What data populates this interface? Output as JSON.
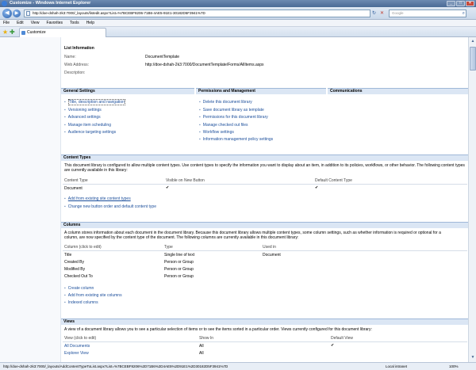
{
  "window": {
    "title": "Customize - Windows Internet Explorer",
    "controls": [
      "_",
      "□",
      "×"
    ]
  },
  "address": {
    "url": "http://doe-dshah-2k3:7000/_layouts/listedit.aspx?List=%7BCEBF8206-71B6-4AE5-91E1-30182D5F3941%7D",
    "search_placeholder": "Google"
  },
  "menu": [
    "File",
    "Edit",
    "View",
    "Favorites",
    "Tools",
    "Help"
  ],
  "tab": {
    "label": "Customize"
  },
  "list_info": {
    "heading": "List Information",
    "name_label": "Name:",
    "name_value": "DocumentTemplate",
    "web_label": "Web Address:",
    "web_value": "http://doe-dshah-2k3:7000/DocumentTemplate/Forms/AllItems.aspx",
    "desc_label": "Description:"
  },
  "settings": {
    "general": {
      "heading": "General Settings",
      "items": [
        "Title, description and navigation",
        "Versioning settings",
        "Advanced settings",
        "Manage item scheduling",
        "Audience targeting settings"
      ]
    },
    "permissions": {
      "heading": "Permissions and Management",
      "items": [
        "Delete this document library",
        "Save document library as template",
        "Permissions for this document library",
        "Manage checked out files",
        "Workflow settings",
        "Information management policy settings"
      ]
    },
    "communications": {
      "heading": "Communications"
    }
  },
  "content_types": {
    "heading": "Content Types",
    "description": "This document library is configured to allow multiple content types. Use content types to specify the information you want to display about an item, in addition to its policies, workflows, or other behavior. The following content types are currently available in this library:",
    "columns": [
      "Content Type",
      "Visible on New Button",
      "Default Content Type"
    ],
    "rows": [
      {
        "name": "Document",
        "visible": "✔",
        "default": "✔"
      }
    ],
    "links": [
      "Add from existing site content types",
      "Change new button order and default content type"
    ]
  },
  "columns_section": {
    "heading": "Columns",
    "description_1": "A column stores information about each document in the document library. Because this document library allows multiple content types, some column settings, such as whether information is required or optional for a",
    "description_2": "column, are now specified by the content type of the document. The following columns are currently available in this document library:",
    "headers": [
      "Column (click to edit)",
      "Type",
      "Used in"
    ],
    "rows": [
      {
        "name": "Title",
        "type": "Single line of text",
        "used": "Document"
      },
      {
        "name": "Created By",
        "type": "Person or Group",
        "used": ""
      },
      {
        "name": "Modified By",
        "type": "Person or Group",
        "used": ""
      },
      {
        "name": "Checked Out To",
        "type": "Person or Group",
        "used": ""
      }
    ],
    "links": [
      "Create column",
      "Add from existing site columns",
      "Indexed columns"
    ]
  },
  "views": {
    "heading": "Views",
    "description": "A view of a document library allows you to see a particular selection of items or to see the items sorted in a particular order. Views currently configured for this document library:",
    "headers": [
      "View (click to edit)",
      "Show In",
      "Default View"
    ],
    "rows": [
      {
        "name": "All Documents",
        "show": "All",
        "default": "✔"
      },
      {
        "name": "Explorer View",
        "show": "All",
        "default": ""
      }
    ]
  },
  "status": {
    "text": "http://doe-dshah-2k3:7000/_layouts/AddContentTypeToList.aspx?List=%7BCEBF8206%2D71B6%2D4AE5%2D91E1%2D30182D5F3941%7D",
    "zone": "Local intranet",
    "zoom": "100%"
  }
}
